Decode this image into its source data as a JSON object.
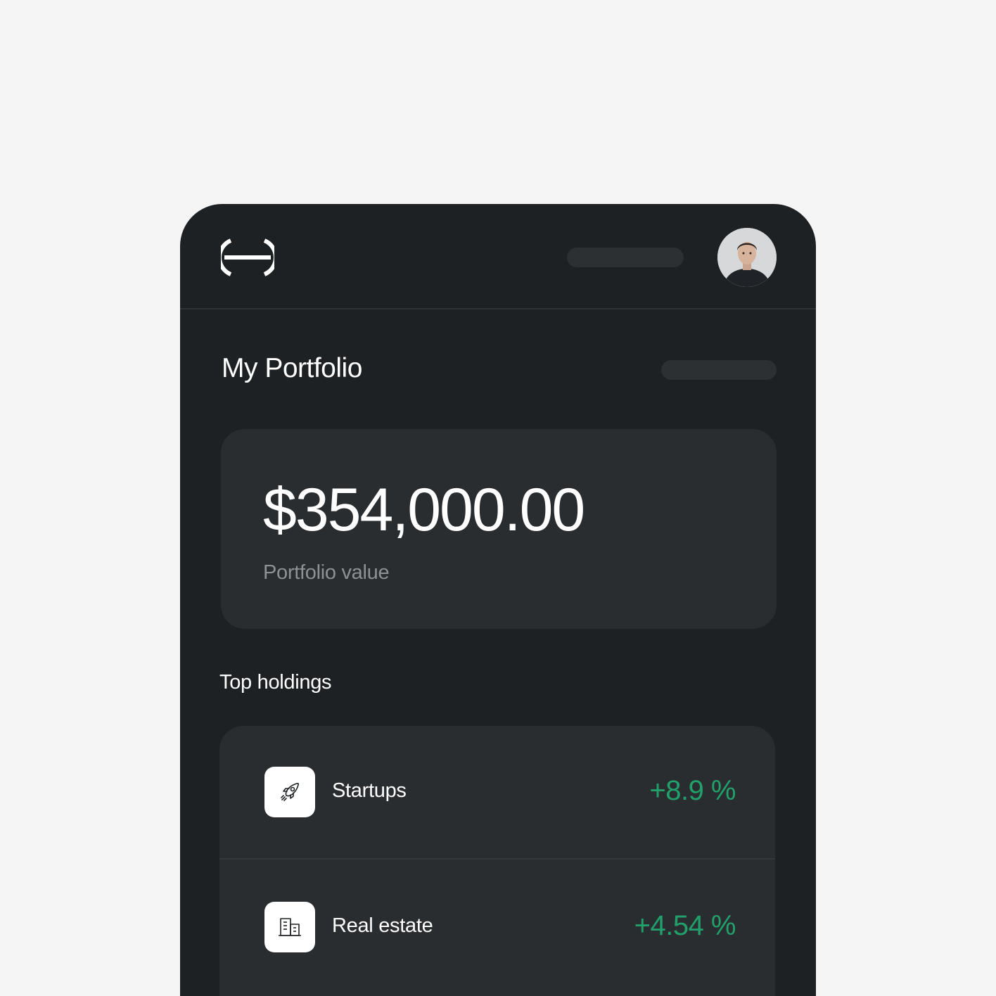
{
  "header": {
    "logo_icon": "brand-logo-icon",
    "avatar_icon": "user-avatar"
  },
  "page": {
    "title": "My Portfolio"
  },
  "portfolio": {
    "value": "$354,000.00",
    "label": "Portfolio value"
  },
  "holdings": {
    "title": "Top holdings",
    "items": [
      {
        "name": "Startups",
        "change": "+8.9 %",
        "icon": "rocket-icon"
      },
      {
        "name": "Real estate",
        "change": "+4.54 %",
        "icon": "building-icon"
      }
    ]
  },
  "colors": {
    "background": "#f5f5f5",
    "panel": "#1e2124",
    "card": "#2a2d30",
    "positive": "#22a06b",
    "muted_text": "#8d9195"
  }
}
